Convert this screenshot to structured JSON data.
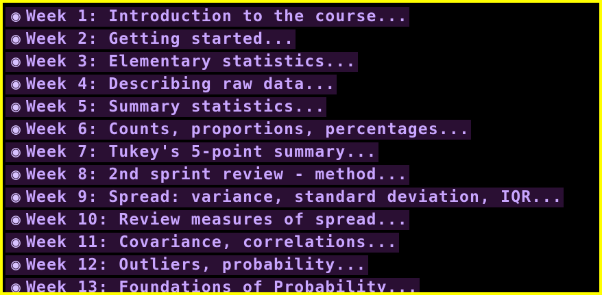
{
  "colors": {
    "frame_border": "#ffff00",
    "background": "#000000",
    "row_highlight": "#2a0f33",
    "text": "#c9a6ff",
    "bullet": "#d7c2ff"
  },
  "bullet_icon": "fisheye-bullet-icon",
  "bullet_glyph": "◉",
  "weeks": [
    "Week 1: Introduction to the course...",
    "Week 2: Getting started...",
    "Week 3: Elementary statistics...",
    "Week 4: Describing raw data...",
    "Week 5: Summary statistics...",
    "Week 6: Counts, proportions, percentages...",
    "Week 7: Tukey's 5-point summary...",
    "Week 8: 2nd sprint review - method...",
    "Week 9: Spread: variance, standard deviation, IQR...",
    "Week 10: Review measures of spread...",
    "Week 11: Covariance, correlations...",
    "Week 12: Outliers, probability...",
    "Week 13: Foundations of Probability..."
  ]
}
